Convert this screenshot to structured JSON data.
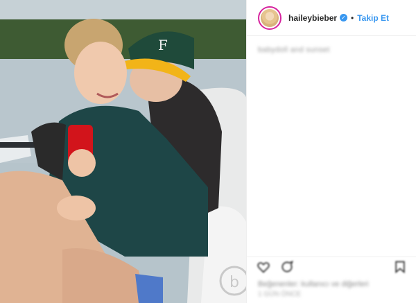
{
  "post": {
    "username": "haileybieber",
    "follow_label": "Takip Et",
    "separator": "•",
    "verified_glyph": "✓",
    "caption_text": "babydoll and sunset",
    "likes_text": "Beğenenler: kullanıcı ve diğerleri",
    "likes_text2": "1 GÜN ÖNCE"
  },
  "icons": {
    "avatar": "avatar",
    "verified": "verified-badge-icon",
    "like": "heart-icon",
    "comment": "comment-icon",
    "save": "bookmark-icon"
  },
  "colors": {
    "link_blue": "#3897f0",
    "ring": "#d6249f",
    "text": "#262626"
  }
}
